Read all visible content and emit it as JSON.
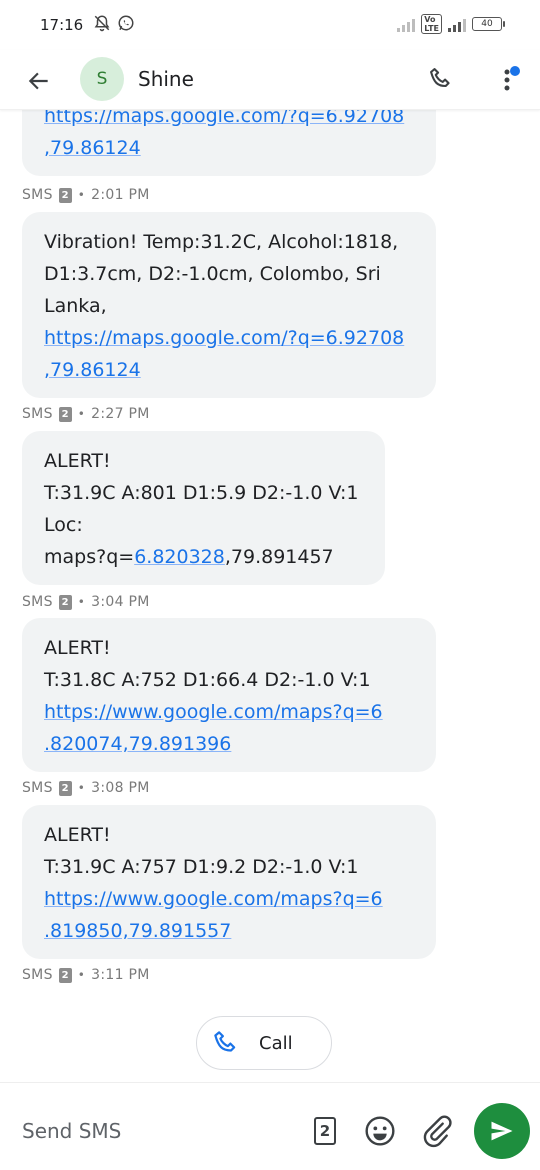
{
  "status_bar": {
    "time": "17:16",
    "battery": "40"
  },
  "header": {
    "avatar_letter": "S",
    "contact_name": "Shine"
  },
  "messages": [
    {
      "lines": [
        "https://maps.google.com/?q=6.92708",
        ",79.86124"
      ],
      "meta": {
        "type": "SMS",
        "sim": "2",
        "time": "2:01 PM"
      }
    },
    {
      "lines": [
        "Vibration! Temp:31.2C, Alcohol:1818,",
        "D1:3.7cm, D2:-1.0cm, Colombo, Sri",
        "Lanka,",
        "https://maps.google.com/?q=6.92708",
        ",79.86124"
      ],
      "meta": {
        "type": "SMS",
        "sim": "2",
        "time": "2:27 PM"
      }
    },
    {
      "lines": [
        "ALERT!",
        "T:31.9C A:801 D1:5.9 D2:-1.0 V:1",
        "Loc:",
        "maps?q=",
        "6.820328",
        ",79.891457"
      ],
      "meta": {
        "type": "SMS",
        "sim": "2",
        "time": "3:04 PM"
      }
    },
    {
      "lines": [
        "ALERT!",
        "T:31.8C A:752 D1:66.4 D2:-1.0 V:1",
        "https://www.google.com/maps?q=6",
        ".820074,79.891396"
      ],
      "meta": {
        "type": "SMS",
        "sim": "2",
        "time": "3:08 PM"
      }
    },
    {
      "lines": [
        "ALERT!",
        "T:31.9C A:757 D1:9.2 D2:-1.0 V:1",
        "https://www.google.com/maps?q=6",
        ".819850,79.891557"
      ],
      "meta": {
        "type": "SMS",
        "sim": "2",
        "time": "3:11 PM"
      }
    }
  ],
  "call_chip": {
    "label": "Call"
  },
  "compose": {
    "placeholder": "Send SMS",
    "sim": "2"
  },
  "colors": {
    "link": "#1a73e8",
    "bubble": "#f1f3f4",
    "send": "#1e8e3e",
    "avatar_bg": "#d7eedb"
  }
}
